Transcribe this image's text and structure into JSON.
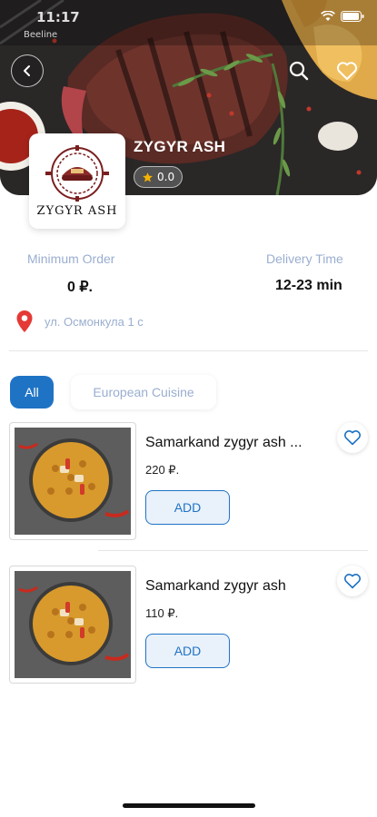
{
  "status_bar": {
    "time": "11:17",
    "carrier": "Beeline"
  },
  "restaurant": {
    "name": "ZYGYR ASH",
    "logo_text": "ZYGYR ASH",
    "rating": "0.0",
    "min_order_label": "Minimum Order",
    "min_order_value": "0 ₽.",
    "delivery_label": "Delivery Time",
    "delivery_value": "12-23 min",
    "address": "ул. Осмонкула 1 с"
  },
  "tabs": [
    {
      "label": "All",
      "active": true
    },
    {
      "label": "European Cuisine",
      "active": false
    }
  ],
  "items": [
    {
      "name": "Samarkand zygyr ash ...",
      "price": "220 ₽.",
      "add_label": "ADD"
    },
    {
      "name": "Samarkand zygyr ash",
      "price": "110 ₽.",
      "add_label": "ADD"
    }
  ],
  "colors": {
    "accent": "#1f73c4",
    "muted": "#9aaed0",
    "pin": "#e53935"
  },
  "icons": [
    "back-arrow-icon",
    "search-icon",
    "heart-outline-icon",
    "star-icon",
    "map-pin-icon",
    "wifi-icon",
    "battery-icon"
  ]
}
